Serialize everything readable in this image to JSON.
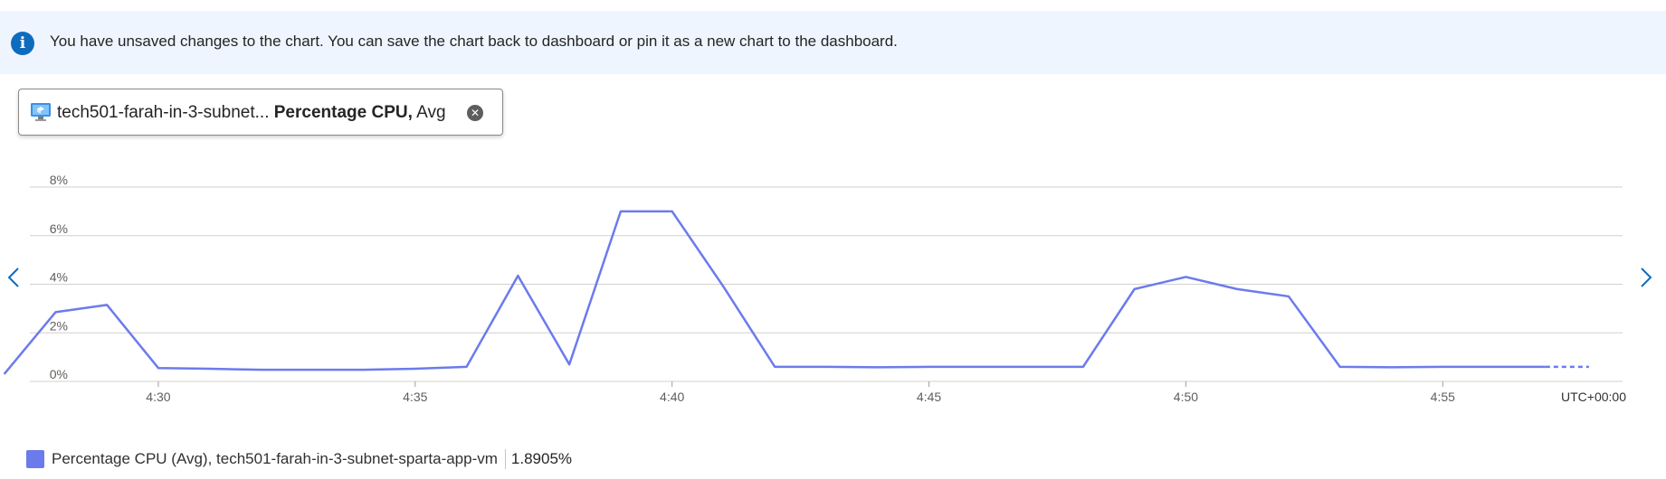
{
  "banner": {
    "icon": "info-icon",
    "text": "You have unsaved changes to the chart. You can save the chart back to dashboard or pin it as a new chart to the dashboard."
  },
  "metric_pill": {
    "resource": "tech501-farah-in-3-subnet...",
    "metric": "Percentage CPU,",
    "aggregation": "Avg",
    "icon": "vm-icon",
    "close_icon": "close-icon"
  },
  "nav": {
    "prev_icon": "chevron-left-icon",
    "next_icon": "chevron-right-icon"
  },
  "legend": {
    "label": "Percentage CPU (Avg), tech501-farah-in-3-subnet-sparta-app-vm",
    "value": "1.8905%"
  },
  "colors": {
    "series": "#6b7bec",
    "accent": "#0f6cbd",
    "grid": "#d2d0ce",
    "banner_bg": "#eef5fe"
  },
  "chart_data": {
    "type": "line",
    "title": "",
    "xlabel": "",
    "ylabel": "",
    "timezone_label": "UTC+00:00",
    "y_ticks": [
      0,
      2,
      4,
      6,
      8
    ],
    "y_tick_labels": [
      "0%",
      "2%",
      "4%",
      "6%",
      "8%"
    ],
    "ylim": [
      0,
      8
    ],
    "x_ticks": [
      "4:30",
      "4:35",
      "4:40",
      "4:45",
      "4:50",
      "4:55"
    ],
    "xlim": [
      "4:27:30",
      "4:58:30"
    ],
    "grid": true,
    "series": [
      {
        "name": "Percentage CPU (Avg), tech501-farah-in-3-subnet-sparta-app-vm",
        "x": [
          "4:27",
          "4:28",
          "4:29",
          "4:30",
          "4:31",
          "4:32",
          "4:33",
          "4:34",
          "4:35",
          "4:36",
          "4:37",
          "4:38",
          "4:39",
          "4:40",
          "4:41",
          "4:42",
          "4:43",
          "4:44",
          "4:45",
          "4:46",
          "4:47",
          "4:48",
          "4:49",
          "4:50",
          "4:51",
          "4:52",
          "4:53",
          "4:54",
          "4:55",
          "4:56",
          "4:57"
        ],
        "y": [
          0.3,
          2.85,
          3.15,
          0.55,
          0.52,
          0.48,
          0.48,
          0.48,
          0.52,
          0.6,
          4.35,
          0.7,
          7.0,
          7.0,
          3.9,
          0.6,
          0.6,
          0.58,
          0.6,
          0.6,
          0.6,
          0.6,
          3.8,
          4.3,
          3.8,
          3.5,
          0.6,
          0.58,
          0.6,
          0.6,
          0.6
        ],
        "partial_from": "4:56"
      }
    ]
  }
}
